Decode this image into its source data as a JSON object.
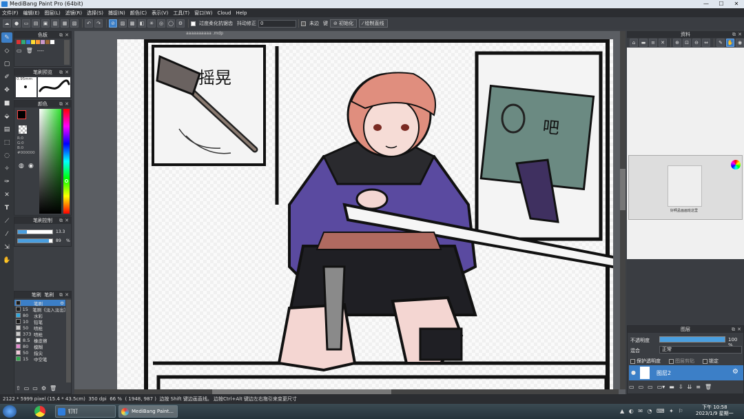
{
  "window": {
    "title": "MediBang Paint Pro (64bit)",
    "controls": [
      "—",
      "☐",
      "✕"
    ]
  },
  "menu": [
    "文件(F)",
    "编辑(E)",
    "图层(L)",
    "滤镜(R)",
    "选择(S)",
    "捕捉(N)",
    "颜色(C)",
    "表示(V)",
    "工具(T)",
    "窗口(W)",
    "Cloud",
    "Help"
  ],
  "toolbar": {
    "antialias_label": "过度柔化抗锯齿",
    "stabilizer_label": "抖动修正",
    "stabilizer_value": "0",
    "edge_label": "未边",
    "key_label": "键",
    "init_button": "初始化",
    "line_button": "绘制直线"
  },
  "document_tab": "aaaaaaaaaa .mdp",
  "left_panels": {
    "palette_title": "色板",
    "palette_none": "----",
    "brush_preview_title": "笔刷预览",
    "brush_size_readout": "0.95mm",
    "color_title": "颜色",
    "rgb": {
      "r": "R:0",
      "g": "G:0",
      "b": "B:0",
      "hex": "#000000"
    },
    "brush_control_title": "笔刷控制",
    "brush_size_value": "13.3",
    "brush_opacity_value": "89",
    "percent": "%",
    "brush_list_headers": [
      "笔刷",
      "笔刷"
    ],
    "brushes": [
      {
        "size": "",
        "name": "笔刷",
        "color": "#1a1a1a",
        "selected": true
      },
      {
        "size": "15",
        "name": "笔刷《淡入淡出》",
        "color": "#1a1a1a",
        "selected": false
      },
      {
        "size": "80",
        "name": "水彩",
        "color": "#2ea8e0",
        "selected": false
      },
      {
        "size": "10",
        "name": "铅笔",
        "color": "#1a1a1a",
        "selected": false
      },
      {
        "size": "50",
        "name": "喷枪",
        "color": "#cccccc",
        "selected": false
      },
      {
        "size": "373",
        "name": "喷枪",
        "color": "#cccccc",
        "selected": false
      },
      {
        "size": "8.5",
        "name": "橡皮擦",
        "color": "#ffffff",
        "selected": false
      },
      {
        "size": "80",
        "name": "模糊",
        "color": "#e58ad0",
        "selected": false
      },
      {
        "size": "50",
        "name": "指尖",
        "color": "#f0c8d8",
        "selected": false
      },
      {
        "size": "15",
        "name": "中空笔",
        "color": "#2ea84a",
        "selected": false
      }
    ]
  },
  "right_panels": {
    "material_title": "资料",
    "layer_title": "图层",
    "opacity_label": "不透明度",
    "opacity_value": "100 %",
    "opacity_fraction": 1.0,
    "blend_label": "混合",
    "blend_value": "正常",
    "protect_alpha_label": "保护透明度",
    "clip_label": "图层剪贴",
    "lock_label": "锁定",
    "layer_name": "图层2",
    "thumbnail_caption": "好啊孟画画班这里"
  },
  "comic_text": {
    "panel1": "摇晃",
    "panel3": "吧"
  },
  "status": {
    "dimensions": "2122 * 5999 pixel",
    "physical": "(15.4 * 43.5cm)",
    "dpi": "350 dpi",
    "zoom": "66 %",
    "cursor": "( 1948, 987 )",
    "hint": "边按 Shift 键边画直线。 边按Ctrl+Alt 键边左右拖引来变更尺寸"
  },
  "taskbar": {
    "apps": [
      {
        "label": "钉钉",
        "color": "#2f7ddc"
      },
      {
        "label": "MediBang Paint...",
        "color": "#e44"
      }
    ],
    "time": "下午 10:58",
    "date": "2023/1/9 星期一"
  },
  "colors": {
    "accent": "#3c7fc7",
    "panel_bg": "#3a3d42",
    "sweater": "#5a4aa0",
    "hair": "#e08e7e"
  }
}
